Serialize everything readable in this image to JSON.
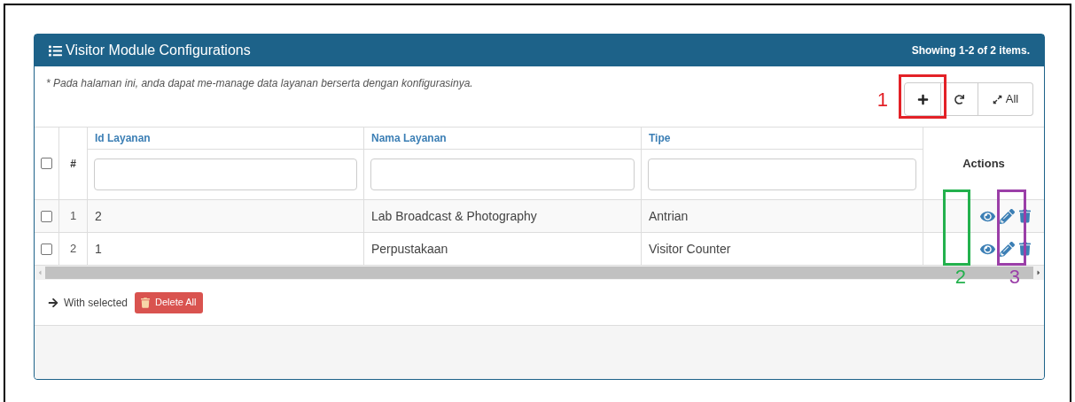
{
  "panel": {
    "title": "Visitor Module Configurations",
    "summary": "Showing 1-2 of 2 items."
  },
  "description": "* Pada halaman ini, anda dapat me-manage data layanan berserta dengan konfigurasinya.",
  "toolbar": [
    {
      "kind": "add"
    },
    {
      "kind": "refresh"
    },
    {
      "kind": "expand",
      "label": "All"
    }
  ],
  "table": {
    "select_all": {
      "checked": false
    },
    "number_heading": "#",
    "columns": [
      "Id Layanan",
      "Nama Layanan",
      "Tipe"
    ],
    "actions_heading": "Actions",
    "rows": [
      {
        "checked": false,
        "number": "1",
        "cells": [
          "2",
          "Lab Broadcast & Photography",
          "Antrian"
        ]
      },
      {
        "checked": false,
        "number": "2",
        "cells": [
          "1",
          "Perpustakaan",
          "Visitor Counter"
        ]
      }
    ]
  },
  "footer": {
    "with_selected": "With selected",
    "delete_button": "Delete All"
  },
  "annotations": [
    {
      "label": "1",
      "color": "#e32127"
    },
    {
      "label": "2",
      "color": "#23b14d"
    },
    {
      "label": "3",
      "color": "#9b3fa8"
    }
  ]
}
